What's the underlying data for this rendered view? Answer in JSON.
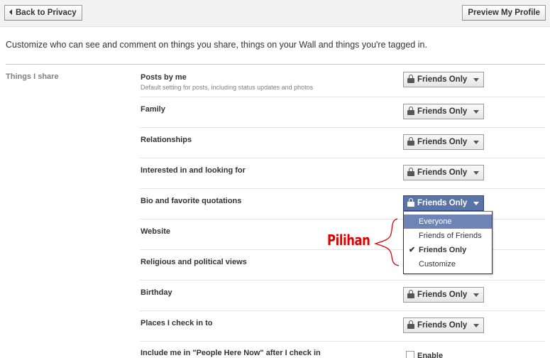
{
  "toolbar": {
    "back_label": "Back to Privacy",
    "preview_label": "Preview My Profile"
  },
  "intro_text": "Customize who can see and comment on things you share, things on your Wall and things you're tagged in.",
  "section": {
    "label": "Things I share"
  },
  "rows": [
    {
      "label": "Posts by me",
      "sublabel": "Default setting for posts, including status updates and photos",
      "value": "Friends Only"
    },
    {
      "label": "Family",
      "value": "Friends Only"
    },
    {
      "label": "Relationships",
      "value": "Friends Only"
    },
    {
      "label": "Interested in and looking for",
      "value": "Friends Only"
    },
    {
      "label": "Bio and favorite quotations",
      "value": "Friends Only"
    },
    {
      "label": "Website"
    },
    {
      "label": "Religious and political views"
    },
    {
      "label": "Birthday",
      "value": "Friends Only"
    },
    {
      "label": "Places I check in to",
      "value": "Friends Only"
    },
    {
      "label": "Include me in \"People Here Now\" after I check in",
      "checkbox_label": "Enable"
    }
  ],
  "dropdown_menu": {
    "items": [
      {
        "label": "Everyone",
        "highlighted": true
      },
      {
        "label": "Friends of Friends"
      },
      {
        "label": "Friends Only",
        "selected": true
      },
      {
        "label": "Customize"
      }
    ]
  },
  "annotation": {
    "text": "Pilihan",
    "color": "#e00000"
  },
  "icons": {
    "lock": "lock-icon",
    "caret": "caret-down-icon",
    "back": "back-arrow-icon",
    "check": "checkmark-icon"
  },
  "colors": {
    "active_select": "#5b74a8",
    "menu_highlight": "#6d84b4"
  }
}
